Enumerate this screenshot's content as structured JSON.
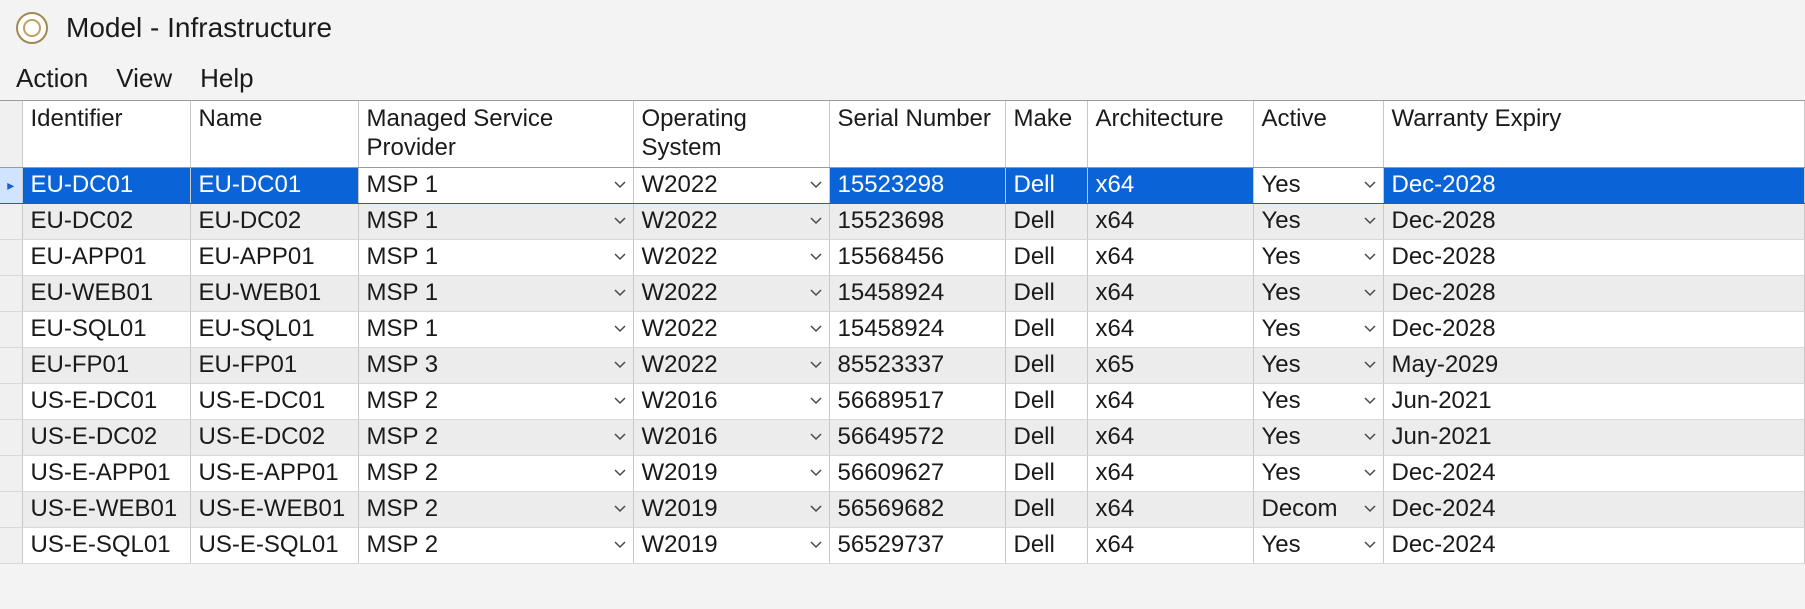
{
  "window": {
    "title": "Model - Infrastructure"
  },
  "menu": {
    "action": "Action",
    "view": "View",
    "help": "Help"
  },
  "columns": {
    "identifier": "Identifier",
    "name": "Name",
    "msp": "Managed Service Provider",
    "os": "Operating System",
    "serial": "Serial Number",
    "make": "Make",
    "arch": "Architecture",
    "active": "Active",
    "warranty": "Warranty Expiry"
  },
  "rows": [
    {
      "identifier": "EU-DC01",
      "name": "EU-DC01",
      "msp": "MSP 1",
      "os": "W2022",
      "serial": "15523298",
      "make": "Dell",
      "arch": "x64",
      "active": "Yes",
      "warranty": "Dec-2028"
    },
    {
      "identifier": "EU-DC02",
      "name": "EU-DC02",
      "msp": "MSP 1",
      "os": "W2022",
      "serial": "15523698",
      "make": "Dell",
      "arch": "x64",
      "active": "Yes",
      "warranty": "Dec-2028"
    },
    {
      "identifier": "EU-APP01",
      "name": "EU-APP01",
      "msp": "MSP 1",
      "os": "W2022",
      "serial": "15568456",
      "make": "Dell",
      "arch": "x64",
      "active": "Yes",
      "warranty": "Dec-2028"
    },
    {
      "identifier": "EU-WEB01",
      "name": "EU-WEB01",
      "msp": "MSP 1",
      "os": "W2022",
      "serial": "15458924",
      "make": "Dell",
      "arch": "x64",
      "active": "Yes",
      "warranty": "Dec-2028"
    },
    {
      "identifier": "EU-SQL01",
      "name": "EU-SQL01",
      "msp": "MSP 1",
      "os": "W2022",
      "serial": "15458924",
      "make": "Dell",
      "arch": "x64",
      "active": "Yes",
      "warranty": "Dec-2028"
    },
    {
      "identifier": "EU-FP01",
      "name": "EU-FP01",
      "msp": "MSP 3",
      "os": "W2022",
      "serial": "85523337",
      "make": "Dell",
      "arch": "x65",
      "active": "Yes",
      "warranty": "May-2029"
    },
    {
      "identifier": "US-E-DC01",
      "name": "US-E-DC01",
      "msp": "MSP 2",
      "os": "W2016",
      "serial": "56689517",
      "make": "Dell",
      "arch": "x64",
      "active": "Yes",
      "warranty": "Jun-2021"
    },
    {
      "identifier": "US-E-DC02",
      "name": "US-E-DC02",
      "msp": "MSP 2",
      "os": "W2016",
      "serial": "56649572",
      "make": "Dell",
      "arch": "x64",
      "active": "Yes",
      "warranty": "Jun-2021"
    },
    {
      "identifier": "US-E-APP01",
      "name": "US-E-APP01",
      "msp": "MSP 2",
      "os": "W2019",
      "serial": "56609627",
      "make": "Dell",
      "arch": "x64",
      "active": "Yes",
      "warranty": "Dec-2024"
    },
    {
      "identifier": "US-E-WEB01",
      "name": "US-E-WEB01",
      "msp": "MSP 2",
      "os": "W2019",
      "serial": "56569682",
      "make": "Dell",
      "arch": "x64",
      "active": "Decom",
      "warranty": "Dec-2024"
    },
    {
      "identifier": "US-E-SQL01",
      "name": "US-E-SQL01",
      "msp": "MSP 2",
      "os": "W2019",
      "serial": "56529737",
      "make": "Dell",
      "arch": "x64",
      "active": "Yes",
      "warranty": "Dec-2024"
    }
  ],
  "selected_row_index": 0
}
